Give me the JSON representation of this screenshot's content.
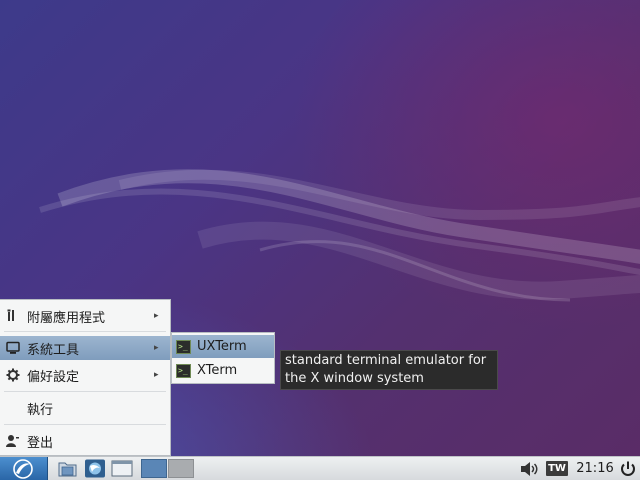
{
  "main_menu": {
    "items": [
      {
        "label": "附屬應用程式",
        "icon": "accessories-icon",
        "has_submenu": true
      },
      {
        "label": "系統工具",
        "icon": "computer-icon",
        "has_submenu": true,
        "active": true
      },
      {
        "label": "偏好設定",
        "icon": "gear-icon",
        "has_submenu": true
      },
      {
        "label": "執行",
        "icon": "",
        "has_submenu": false
      },
      {
        "label": "登出",
        "icon": "user-icon",
        "has_submenu": false
      }
    ],
    "arrow_glyph": "▸"
  },
  "sub_menu": {
    "items": [
      {
        "label": "UXTerm",
        "icon": "terminal-icon",
        "active": true
      },
      {
        "label": "XTerm",
        "icon": "terminal-icon"
      }
    ],
    "terminal_glyph": ">_"
  },
  "tooltip": {
    "text": "standard terminal emulator for\nthe X window system"
  },
  "taskbar": {
    "keyboard_layout": "TW",
    "clock": "21:16"
  },
  "colors": {
    "menu_highlight": "#8fa9c6",
    "taskbar_bg": "#e3e6e8",
    "start_button": "#3b7bbd",
    "active_workspace": "#5a86b6"
  }
}
